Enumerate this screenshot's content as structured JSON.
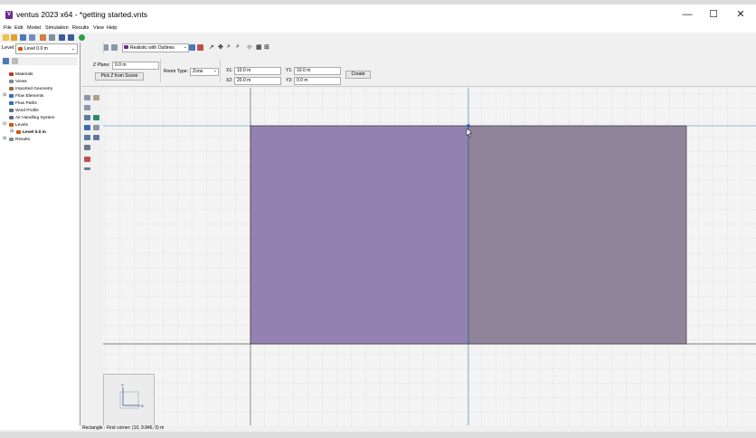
{
  "window": {
    "title": "ventus 2023 x64 - *getting started.vnts",
    "app_icon_letter": "V",
    "minimize_icon": "—",
    "maximize_icon": "☐",
    "close_icon": "✕"
  },
  "menu": [
    "File",
    "Edit",
    "Model",
    "Simulation",
    "Results",
    "View",
    "Help"
  ],
  "sidebar": {
    "level_label": "Level:",
    "level_value": "Level 0.0 m",
    "tree": [
      {
        "label": "Materials",
        "color": "#c0392b"
      },
      {
        "label": "Views",
        "color": "#7f8c8d"
      },
      {
        "label": "Imported Geometry",
        "color": "#8e6f3e"
      },
      {
        "label": "Flow Elements",
        "color": "#2c6fbb"
      },
      {
        "label": "Flow Paths",
        "color": "#2c6fbb"
      },
      {
        "label": "Wind Profile",
        "color": "#5d6d7e"
      },
      {
        "label": "Air Handling System",
        "color": "#5d6d7e"
      },
      {
        "label": "Levels",
        "color": "#d35400"
      },
      {
        "label": "Level 0.0 m",
        "color": "#d35400"
      },
      {
        "label": "Results",
        "color": "#7f8c8d"
      }
    ]
  },
  "toolbar": {
    "view_mode": "Realistic with Outlines"
  },
  "properties": {
    "z_plane_label": "Z Plane:",
    "z_plane_value": "0.0 m",
    "pick_z_button": "Pick Z from Scene",
    "room_type_label": "Room Type:",
    "room_type_value": "Zone",
    "x1_label": "X1:",
    "x1_value": "10.0 m",
    "y1_label": "Y1:",
    "y1_value": "10.0 m",
    "x2_label": "X2:",
    "x2_value": "20.0 m",
    "y2_label": "Y2:",
    "y2_value": "0.0 m",
    "create_button": "Create"
  },
  "status": {
    "text": "Rectangle - First corner: (10, 9.846, 0) m"
  },
  "colors": {
    "room_left": "#9481b2",
    "room_right": "#8f8499",
    "accent_axis": "#2a7fa8"
  },
  "minimap": {
    "axis_y": "Y",
    "axis_x": "X"
  }
}
